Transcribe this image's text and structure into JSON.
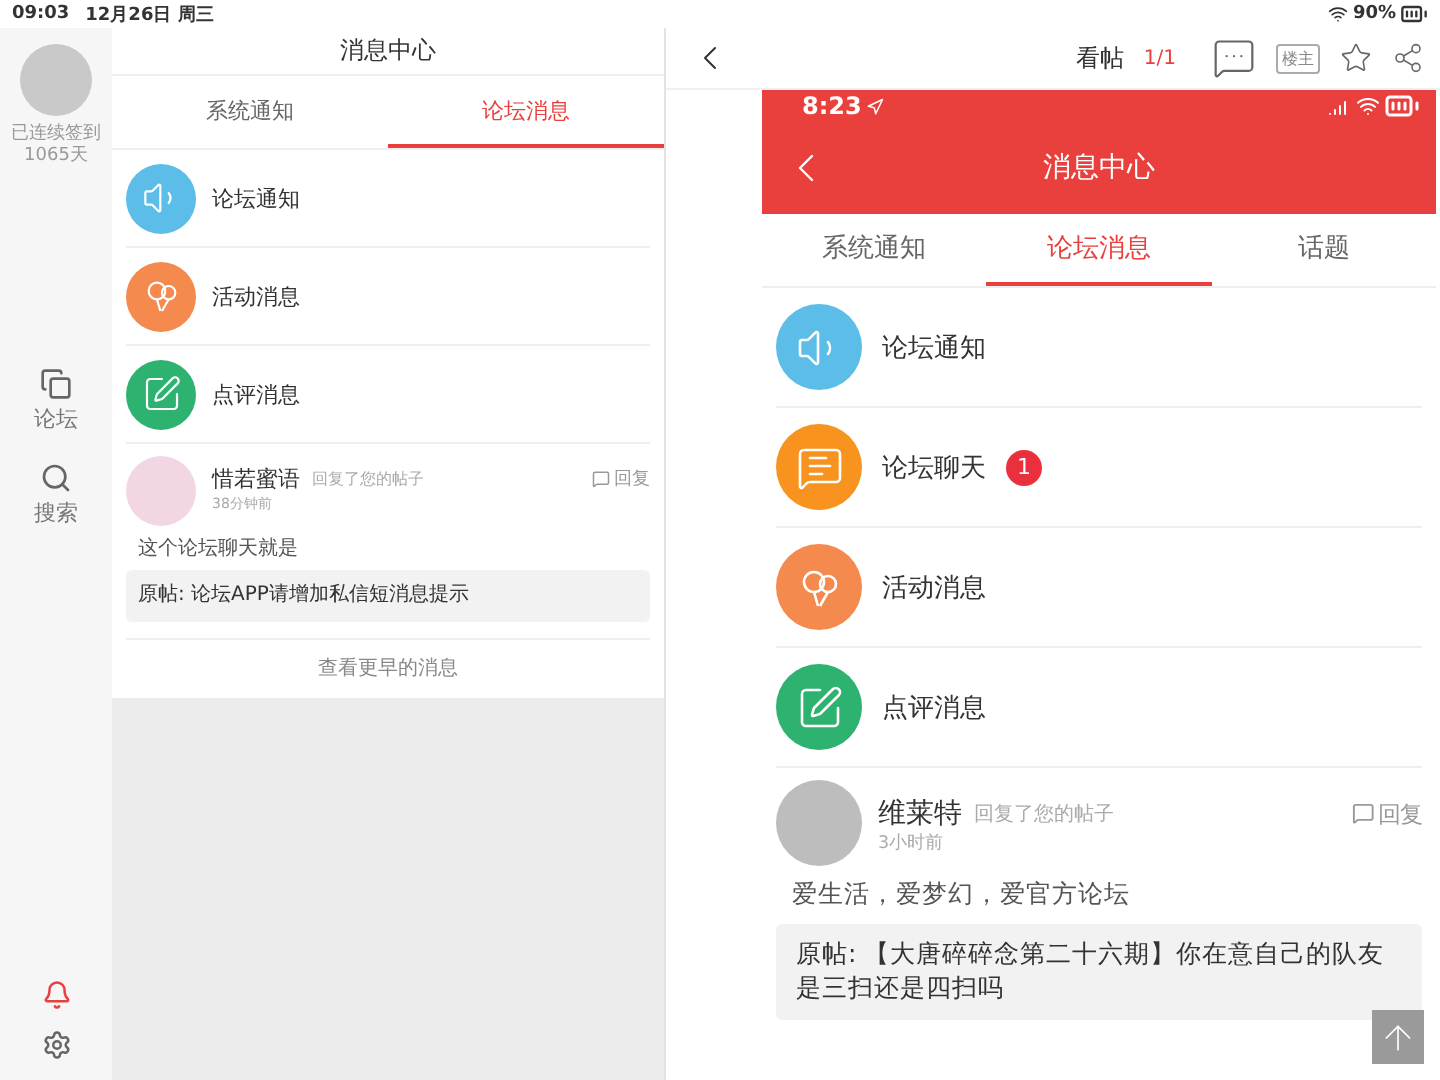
{
  "status_bar": {
    "time": "09:03",
    "date": "12月26日 周三",
    "battery": "90%"
  },
  "sidebar": {
    "streak": [
      "已连续签到",
      "1065天"
    ],
    "nav": [
      {
        "kind": "forum",
        "label": "论坛",
        "selected": false
      },
      {
        "kind": "search",
        "label": "搜索",
        "selected": false
      }
    ],
    "bottom": [
      {
        "kind": "bell",
        "selected": true
      },
      {
        "kind": "gear",
        "selected": false
      }
    ]
  },
  "message_center": {
    "title": "消息中心",
    "tabs": [
      {
        "label": "系统通知",
        "selected": false
      },
      {
        "label": "论坛消息",
        "selected": true
      }
    ],
    "categories": [
      {
        "kind": "speaker",
        "label": "论坛通知",
        "color": "#5bbde8"
      },
      {
        "kind": "balloons",
        "label": "活动消息",
        "color": "#f58a4e"
      },
      {
        "kind": "pen",
        "label": "点评消息",
        "color": "#2db36f"
      }
    ],
    "posts": [
      {
        "user": "惜若蜜语",
        "action": "回复了您的帖子",
        "time": "38分钟前",
        "reply": "回复",
        "text": "这个论坛聊天就是",
        "original": "原帖: 论坛APP请增加私信短消息提示"
      }
    ],
    "more": "查看更早的消息"
  },
  "thread": {
    "title": "看帖",
    "page": "1/1",
    "host": "楼主",
    "screenshot": {
      "time": "8:23",
      "title": "消息中心",
      "tabs": [
        {
          "label": "系统通知",
          "selected": false
        },
        {
          "label": "论坛消息",
          "selected": true
        },
        {
          "label": "话题",
          "selected": false
        }
      ],
      "categories": [
        {
          "kind": "speaker",
          "label": "论坛通知",
          "color": "#5bbde8"
        },
        {
          "kind": "chat",
          "label": "论坛聊天",
          "color": "#f7931e",
          "badge": "1"
        },
        {
          "kind": "balloons",
          "label": "活动消息",
          "color": "#f58a4e"
        },
        {
          "kind": "pen",
          "label": "点评消息",
          "color": "#2db36f"
        }
      ],
      "posts": [
        {
          "user": "维莱特",
          "action": "回复了您的帖子",
          "time": "3小时前",
          "reply": "回复",
          "text": "爱生活，爱梦幻，爱官方论坛",
          "original": "原帖: 【大唐碎碎念第二十六期】你在意自己的队友是三扫还是四扫吗"
        }
      ]
    }
  }
}
